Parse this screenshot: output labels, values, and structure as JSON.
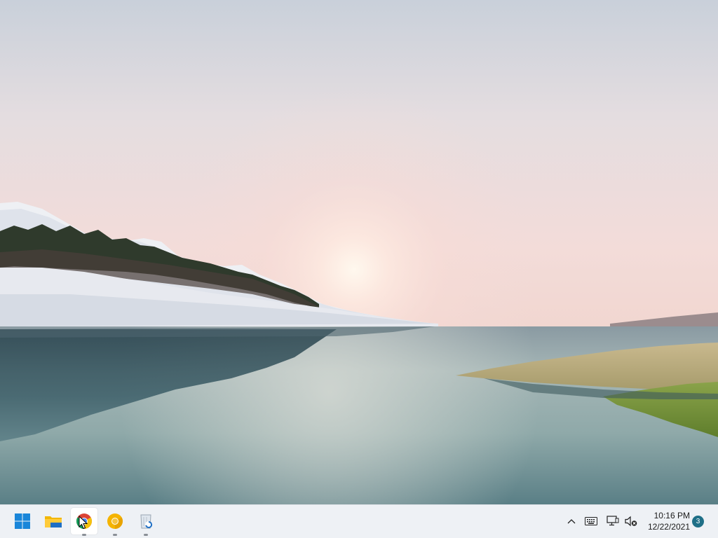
{
  "desktop": {
    "wallpaper": "lake-sunrise-wallpaper"
  },
  "taskbar": {
    "apps": [
      {
        "name": "Start",
        "icon": "windows-start-icon",
        "running": false
      },
      {
        "name": "File Explorer",
        "icon": "file-explorer-icon",
        "running": false
      },
      {
        "name": "Chrome",
        "icon": "chrome-icon",
        "running": true,
        "active": true
      },
      {
        "name": "Chrome Canary",
        "icon": "chrome-canary-icon",
        "running": true
      },
      {
        "name": "Recycle Bin",
        "icon": "recycle-bin-icon",
        "running": true
      }
    ],
    "tray": {
      "icons": [
        "chevron-up-icon",
        "keyboard-icon",
        "network-icon",
        "volume-muted-icon"
      ]
    },
    "clock": {
      "time": "10:16 PM",
      "date": "12/22/2021"
    },
    "notifications": {
      "count": "3"
    }
  },
  "colors": {
    "taskbar_bg": "#eef1f5",
    "start_blue": "#0078d4",
    "notification_badge": "#1f6f87"
  }
}
